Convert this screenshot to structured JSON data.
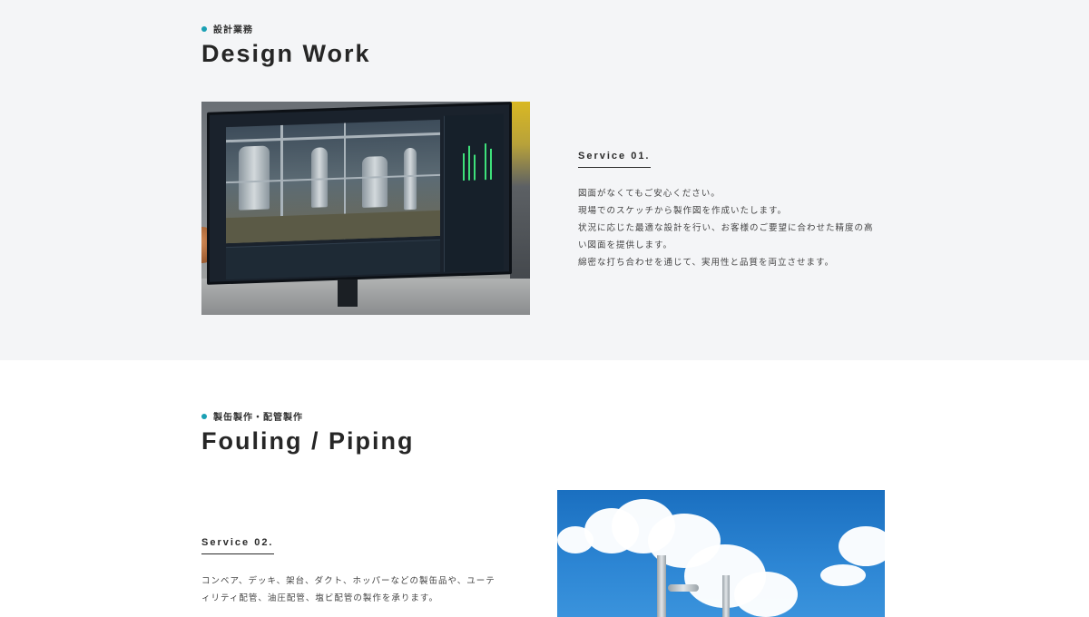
{
  "colors": {
    "accent": "#1aa0b4",
    "section_bg": "#f4f5f7",
    "text": "#2a2a2a"
  },
  "section1": {
    "kicker": "設計業務",
    "heading": "Design Work",
    "service_label": "Service 01.",
    "body": [
      "図面がなくてもご安心ください。",
      "現場でのスケッチから製作図を作成いたします。",
      "状況に応じた最適な設計を行い、お客様のご要望に合わせた精度の高",
      "い図面を提供します。",
      "綿密な打ち合わせを通じて、実用性と品質を両立させます。"
    ]
  },
  "section2": {
    "kicker": "製缶製作・配管製作",
    "heading": "Fouling / Piping",
    "service_label": "Service 02.",
    "body": [
      "コンベア、デッキ、架台、ダクト、ホッパーなどの製缶品や、ユーテ",
      "ィリティ配管、油圧配管、塩ビ配管の製作を承ります。"
    ]
  }
}
